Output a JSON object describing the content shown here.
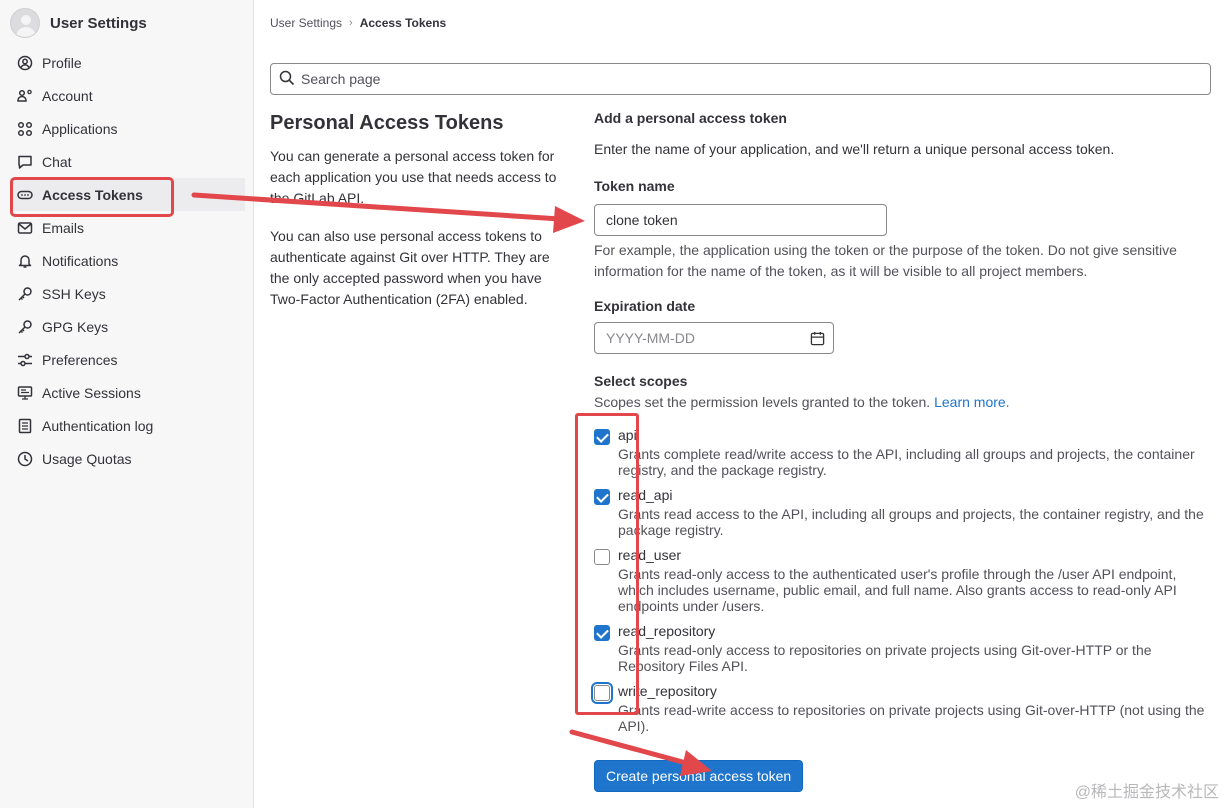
{
  "sidebar": {
    "title": "User Settings",
    "items": [
      {
        "label": "Profile",
        "icon": "profile-icon"
      },
      {
        "label": "Account",
        "icon": "account-icon"
      },
      {
        "label": "Applications",
        "icon": "applications-icon"
      },
      {
        "label": "Chat",
        "icon": "chat-icon"
      },
      {
        "label": "Access Tokens",
        "icon": "token-icon",
        "active": true
      },
      {
        "label": "Emails",
        "icon": "email-icon"
      },
      {
        "label": "Notifications",
        "icon": "bell-icon"
      },
      {
        "label": "SSH Keys",
        "icon": "key-icon"
      },
      {
        "label": "GPG Keys",
        "icon": "key-icon"
      },
      {
        "label": "Preferences",
        "icon": "preferences-icon"
      },
      {
        "label": "Active Sessions",
        "icon": "monitor-icon"
      },
      {
        "label": "Authentication log",
        "icon": "log-icon"
      },
      {
        "label": "Usage Quotas",
        "icon": "quota-icon"
      }
    ]
  },
  "breadcrumb": {
    "parent": "User Settings",
    "separator": "›",
    "current": "Access Tokens"
  },
  "search": {
    "placeholder": "Search page"
  },
  "intro": {
    "title": "Personal Access Tokens",
    "p1": "You can generate a personal access token for each application you use that needs access to the GitLab API.",
    "p2": "You can also use personal access tokens to authenticate against Git over HTTP. They are the only accepted password when you have Two-Factor Authentication (2FA) enabled."
  },
  "form": {
    "heading": "Add a personal access token",
    "subheading": "Enter the name of your application, and we'll return a unique personal access token.",
    "token_name_label": "Token name",
    "token_name_value": "clone token",
    "token_name_help": "For example, the application using the token or the purpose of the token. Do not give sensitive information for the name of the token, as it will be visible to all project members.",
    "expiration_label": "Expiration date",
    "expiration_placeholder": "YYYY-MM-DD",
    "scopes_label": "Select scopes",
    "scopes_help": "Scopes set the permission levels granted to the token.",
    "learn_more": "Learn more.",
    "submit_label": "Create personal access token"
  },
  "scopes": [
    {
      "name": "api",
      "checked": true,
      "desc": "Grants complete read/write access to the API, including all groups and projects, the container registry, and the package registry."
    },
    {
      "name": "read_api",
      "checked": true,
      "desc": "Grants read access to the API, including all groups and projects, the container registry, and the package registry."
    },
    {
      "name": "read_user",
      "checked": false,
      "desc": "Grants read-only access to the authenticated user's profile through the /user API endpoint, which includes username, public email, and full name. Also grants access to read-only API endpoints under /users."
    },
    {
      "name": "read_repository",
      "checked": true,
      "desc": "Grants read-only access to repositories on private projects using Git-over-HTTP or the Repository Files API."
    },
    {
      "name": "write_repository",
      "checked": false,
      "focused": true,
      "desc": "Grants read-write access to repositories on private projects using Git-over-HTTP (not using the API)."
    }
  ],
  "colors": {
    "annotation": "#e2474b",
    "primary": "#1f75cb"
  },
  "watermark": "@稀土掘金技术社区"
}
